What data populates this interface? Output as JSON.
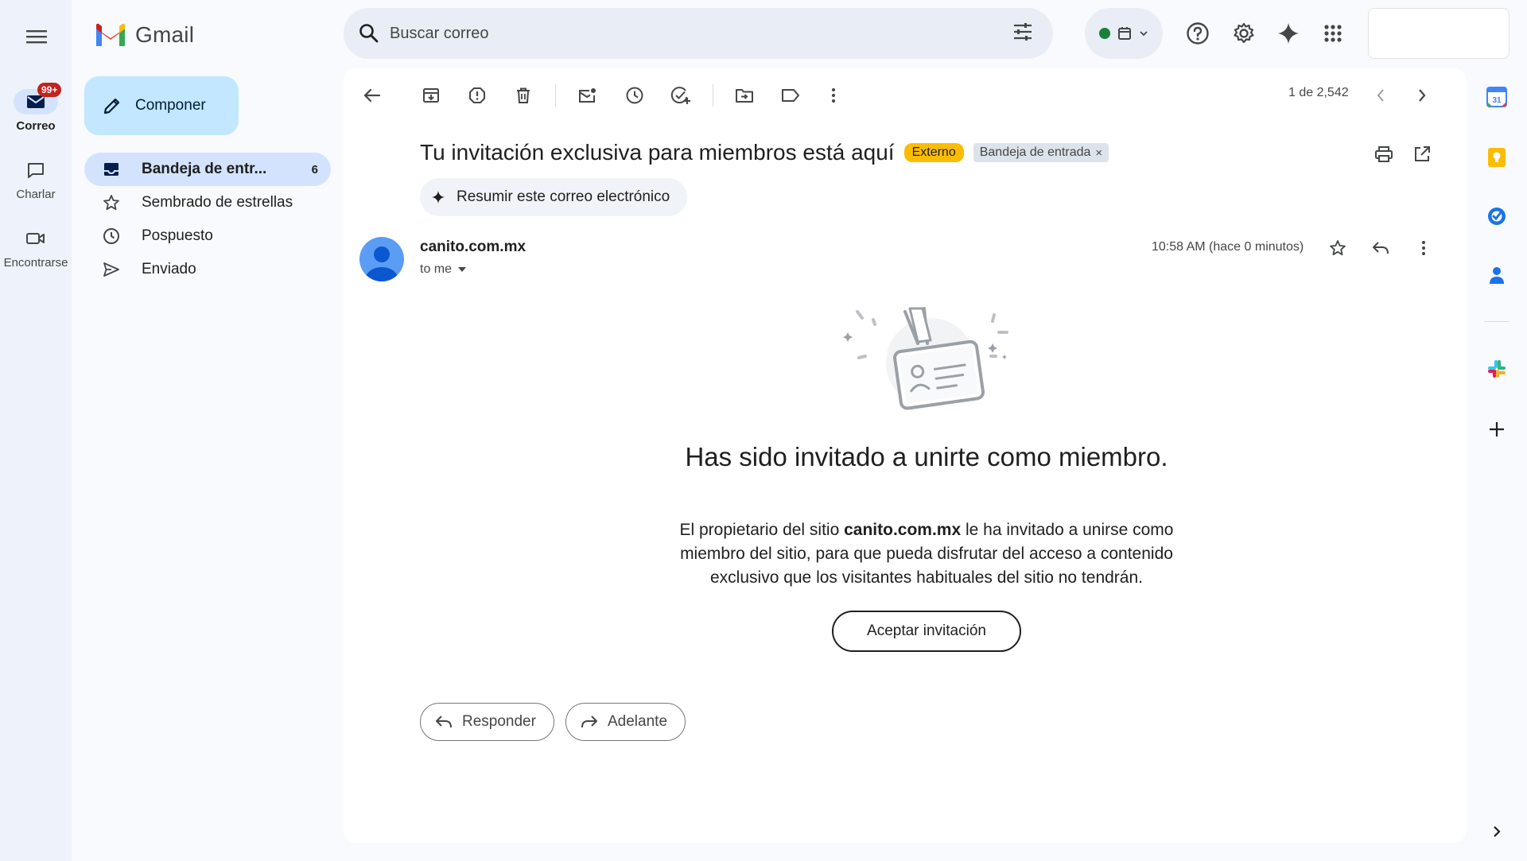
{
  "app": {
    "logo_text": "Gmail"
  },
  "rail": {
    "mail_label": "Correo",
    "mail_badge": "99+",
    "chat_label": "Charlar",
    "meet_label": "Encontrarse"
  },
  "search": {
    "placeholder": "Buscar correo"
  },
  "compose": {
    "label": "Componer"
  },
  "nav": {
    "items": [
      {
        "label": "Bandeja de entr...",
        "count": "6"
      },
      {
        "label": "Sembrado de estrellas",
        "count": ""
      },
      {
        "label": "Pospuesto",
        "count": ""
      },
      {
        "label": "Enviado",
        "count": ""
      }
    ]
  },
  "toolbar": {
    "pager": "1 de 2,542"
  },
  "email": {
    "subject": "Tu invitación exclusiva para miembros está aquí",
    "tag_external": "Externo",
    "tag_inbox": "Bandeja de entrada",
    "tag_inbox_close": "×",
    "summarize_label": "Resumir este correo electrónico",
    "sender": "canito.com.mx",
    "to": "to me",
    "time": "10:58 AM (hace 0 minutos)",
    "headline": "Has sido invitado a unirte como miembro.",
    "body_prefix": "El propietario del sitio ",
    "body_bold": "canito.com.mx",
    "body_suffix": " le ha invitado a unirse como miembro del sitio, para que pueda disfrutar del acceso a contenido exclusivo que los visitantes habituales del sitio no tendrán.",
    "accept_label": "Aceptar invitación",
    "reply_label": "Responder",
    "forward_label": "Adelante"
  },
  "side_panel": {
    "calendar_day": "31"
  },
  "colors": {
    "accent": "#0b57d0",
    "compose_bg": "#c2e7ff",
    "nav_active": "#d3e3fd",
    "badge": "#c5221f",
    "external_tag": "#fbbc04",
    "status_dot": "#188038"
  }
}
